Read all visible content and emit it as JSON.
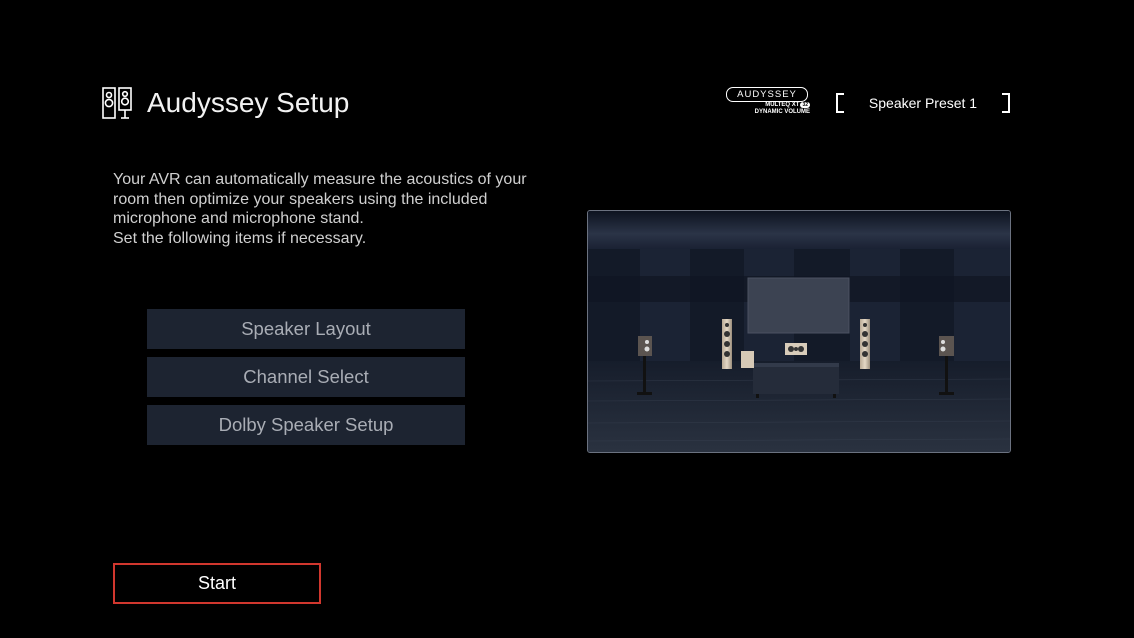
{
  "header": {
    "title": "Audyssey Setup",
    "icon": "speakers-icon",
    "logo": {
      "brand": "AUDYSSEY",
      "line1": "MULTEQ XT",
      "line1_badge": "32",
      "line2": "DYNAMIC VOLUME"
    },
    "preset": "Speaker Preset 1"
  },
  "description": {
    "lines": [
      "Your AVR can automatically measure the acoustics of your room then optimize your speakers using the included microphone and microphone stand.",
      "Set the following items if necessary."
    ]
  },
  "menu": {
    "items": [
      {
        "label": "Speaker Layout"
      },
      {
        "label": "Channel Select"
      },
      {
        "label": "Dolby Speaker Setup"
      }
    ]
  },
  "start_button": {
    "label": "Start",
    "accent": "#d1372e"
  },
  "colors": {
    "background": "#000000",
    "menu_bg": "#1d2431",
    "menu_text": "#a9adb5"
  }
}
